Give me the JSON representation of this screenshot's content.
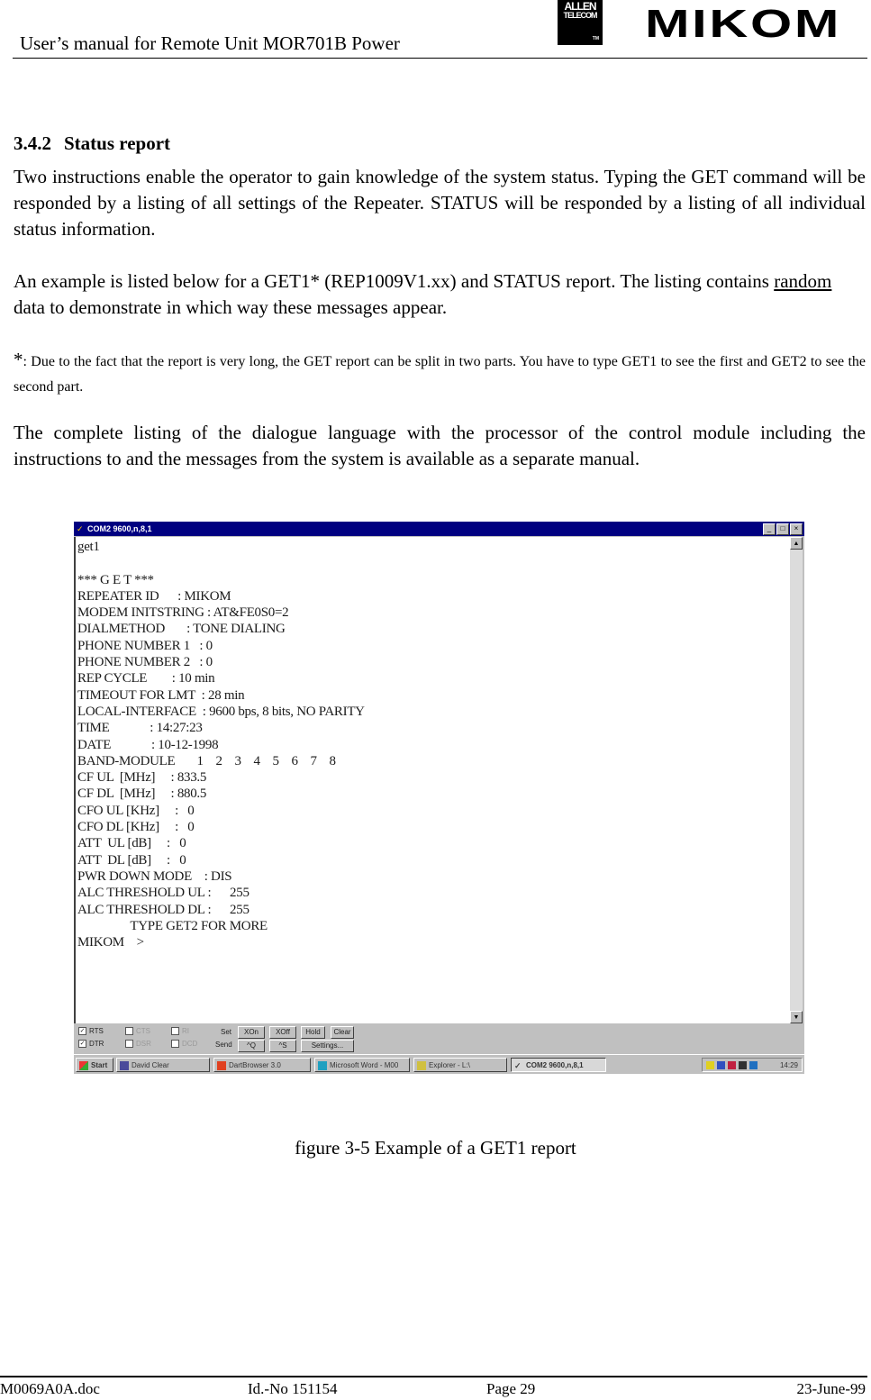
{
  "header": {
    "title": "User’s manual for Remote Unit MOR701B Power",
    "logo_allen_line1": "ALLEN",
    "logo_allen_line2": "TELECOM",
    "logo_allen_tm": "TM",
    "logo_mikom": "MIKOM"
  },
  "section": {
    "number": "3.4.2",
    "title": "Status report"
  },
  "paragraphs": {
    "p1": "Two instructions enable the operator to gain knowledge of the system status. Typing the GET command will be responded by a listing of all settings of the Repeater. STATUS will be responded by a listing of all individual status information.",
    "p2_a": "An example is listed below for a GET1* (REP1009V1.xx) and STATUS report. The listing contains ",
    "p2_underlined": "random",
    "p2_b": " data to demonstrate in which way these messages appear.",
    "p3_star": "*",
    "p3": ": Due to the fact that the report is very long, the GET report can be split in two parts. You have to type GET1 to see the first and GET2 to see the second part.",
    "p4": "The complete listing of the dialogue language with the processor of the control module including the instructions to and the messages from the system is available as a separate manual."
  },
  "figure": {
    "window_title": "COM2 9600,n,8,1",
    "window_buttons": {
      "minimize": "_",
      "maximize": "□",
      "close": "×"
    },
    "terminal_lines": [
      "get1",
      "",
      "*** G E T ***",
      "REPEATER ID      : MIKOM",
      "MODEM INITSTRING : AT&FE0S0=2",
      "DIALMETHOD       : TONE DIALING",
      "PHONE NUMBER 1   : 0",
      "PHONE NUMBER 2   : 0",
      "REP CYCLE        : 10 min",
      "TIMEOUT FOR LMT  : 28 min",
      "LOCAL-INTERFACE  : 9600 bps, 8 bits, NO PARITY",
      "TIME             : 14:27:23",
      "DATE             : 10-12-1998",
      "BAND-MODULE       1    2    3    4    5    6    7    8",
      "CF UL  [MHz]     : 833.5",
      "CF DL  [MHz]     : 880.5",
      "CFO UL [KHz]     :   0",
      "CFO DL [KHz]     :   0",
      "ATT  UL [dB]     :   0",
      "ATT  DL [dB]     :   0",
      "PWR DOWN MODE    : DIS",
      "ALC THRESHOLD UL :      255",
      "ALC THRESHOLD DL :      255",
      "                 TYPE GET2 FOR MORE",
      "MIKOM    >"
    ],
    "controls": {
      "checkbox_rts": "RTS",
      "checkbox_dtr": "DTR",
      "checkbox_cts": "CTS",
      "checkbox_dsr": "DSR",
      "checkbox_ri": "RI",
      "checkbox_dcd": "DCD",
      "label_set": "Set",
      "label_send": "Send",
      "btn_xon": "XOn",
      "btn_xoff": "XOff",
      "btn_hold": "Hold",
      "btn_clear": "Clear",
      "btn_q": "^Q",
      "btn_s": "^S",
      "btn_settings": "Settings..."
    },
    "taskbar": {
      "start": "Start",
      "items": [
        "David Clear",
        "DartBrowser 3.0",
        "Microsoft Word - M00",
        "Explorer - L:\\",
        "COM2 9600,n,8,1"
      ],
      "clock": "14:29"
    },
    "caption": "figure 3-5 Example of a GET1 report"
  },
  "footer": {
    "doc": "M0069A0A.doc",
    "id": "Id.-No 151154",
    "page": "Page 29",
    "date": "23-June-99"
  }
}
